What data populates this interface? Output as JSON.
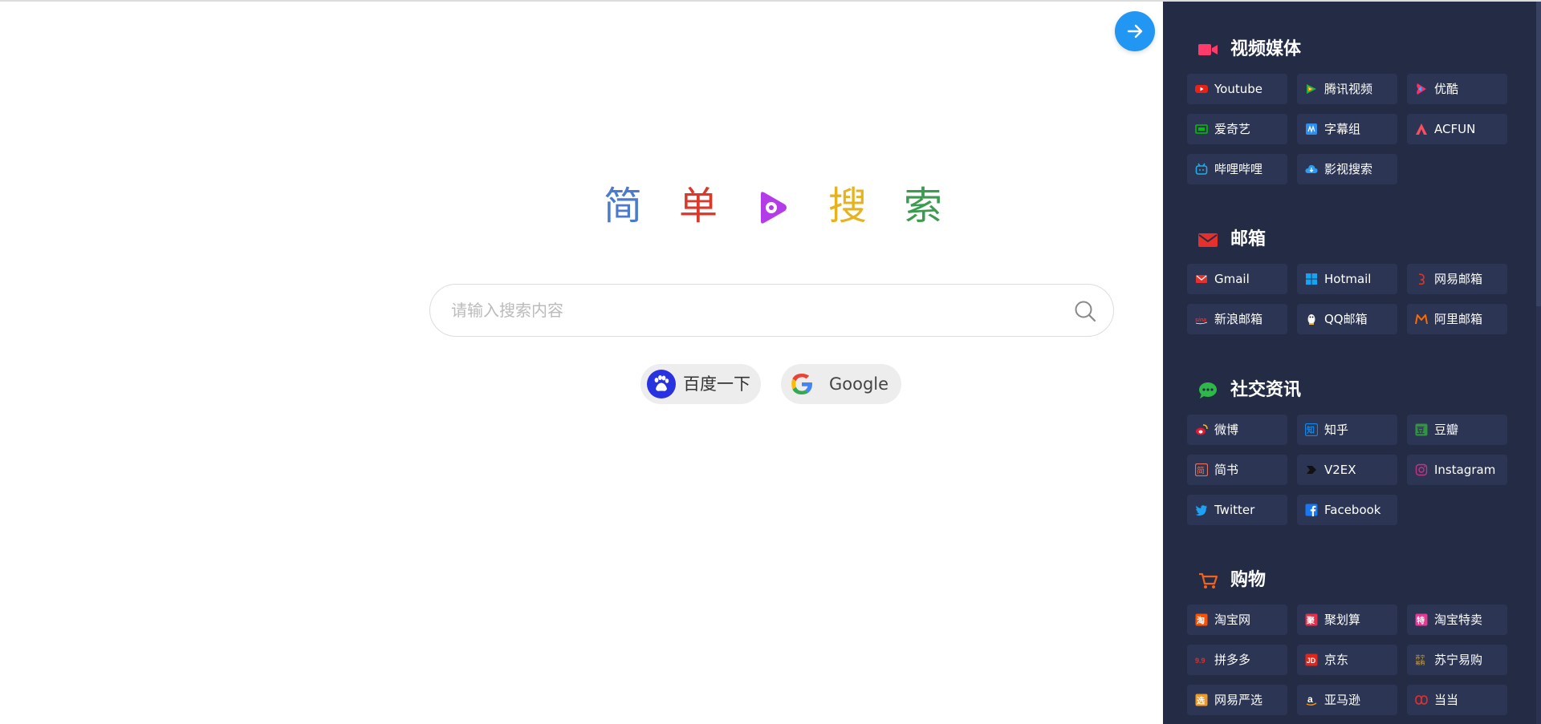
{
  "logo": {
    "chars": [
      "简",
      "单",
      "搜",
      "索"
    ],
    "colors": [
      "#4a7bd0",
      "#d9382b",
      "#e6b31e",
      "#3c9a51"
    ],
    "mark_color": "#b43ce8"
  },
  "search": {
    "placeholder": "请输入搜索内容",
    "value": ""
  },
  "engines": [
    {
      "label": "百度一下",
      "icon": "baidu-paw-icon"
    },
    {
      "label": "Google",
      "icon": "google-g-icon"
    }
  ],
  "toggle": {
    "icon": "arrow-right-icon",
    "color": "#2196f3"
  },
  "sidebar": {
    "background": "#232b45",
    "sections": [
      {
        "title": "视频媒体",
        "icon": "video-camera-icon",
        "icon_color": "#ff3b6b",
        "links": [
          {
            "label": "Youtube",
            "icon": "youtube-icon",
            "color": "#e62117"
          },
          {
            "label": "腾讯视频",
            "icon": "tencent-video-icon",
            "color": "#20b14a"
          },
          {
            "label": "优酷",
            "icon": "youku-icon",
            "color": "#ff2d6f"
          },
          {
            "label": "爱奇艺",
            "icon": "iqiyi-icon",
            "color": "#00be06"
          },
          {
            "label": "字幕组",
            "icon": "subtitle-icon",
            "color": "#2f8ff0"
          },
          {
            "label": "ACFUN",
            "icon": "acfun-icon",
            "color": "#fd4c5d"
          },
          {
            "label": "哔哩哔哩",
            "icon": "bilibili-icon",
            "color": "#23ade5"
          },
          {
            "label": "影视搜索",
            "icon": "cloud-icon",
            "color": "#2b9cf2"
          }
        ]
      },
      {
        "title": "邮箱",
        "icon": "envelope-icon",
        "icon_color": "#e5302b",
        "links": [
          {
            "label": "Gmail",
            "icon": "gmail-icon",
            "color": "#e5302b"
          },
          {
            "label": "Hotmail",
            "icon": "windows-icon",
            "color": "#12a5f4"
          },
          {
            "label": "网易邮箱",
            "icon": "netease-icon",
            "color": "#d6362b"
          },
          {
            "label": "新浪邮箱",
            "icon": "sina-icon",
            "color": "#e5302b"
          },
          {
            "label": "QQ邮箱",
            "icon": "qq-penguin-icon",
            "color": "#ffffff"
          },
          {
            "label": "阿里邮箱",
            "icon": "aliyun-mail-icon",
            "color": "#ff6a00"
          }
        ]
      },
      {
        "title": "社交资讯",
        "icon": "chat-bubble-icon",
        "icon_color": "#2fb84a",
        "links": [
          {
            "label": "微博",
            "icon": "weibo-icon",
            "color": "#e6162d"
          },
          {
            "label": "知乎",
            "icon": "zhihu-icon",
            "color": "#0f88eb"
          },
          {
            "label": "豆瓣",
            "icon": "douban-icon",
            "color": "#2e963d"
          },
          {
            "label": "简书",
            "icon": "jianshu-icon",
            "color": "#ea6f5a"
          },
          {
            "label": "V2EX",
            "icon": "v2ex-icon",
            "color": "#111111"
          },
          {
            "label": "Instagram",
            "icon": "instagram-icon",
            "color": "#c13584"
          },
          {
            "label": "Twitter",
            "icon": "twitter-bird-icon",
            "color": "#1da1f2"
          },
          {
            "label": "Facebook",
            "icon": "facebook-icon",
            "color": "#1877f2"
          }
        ]
      },
      {
        "title": "购物",
        "icon": "shopping-cart-icon",
        "icon_color": "#f0631e",
        "links": [
          {
            "label": "淘宝网",
            "icon": "taobao-icon",
            "color": "#ff5000"
          },
          {
            "label": "聚划算",
            "icon": "juhuasuan-icon",
            "color": "#e5304b"
          },
          {
            "label": "淘宝特卖",
            "icon": "temai-icon",
            "color": "#e53994"
          },
          {
            "label": "拼多多",
            "icon": "pinduoduo-icon",
            "color": "#e02e24"
          },
          {
            "label": "京东",
            "icon": "jd-icon",
            "color": "#e1251b"
          },
          {
            "label": "苏宁易购",
            "icon": "suning-icon",
            "color": "#f9b61b"
          },
          {
            "label": "网易严选",
            "icon": "yanxuan-icon",
            "color": "#f09a25"
          },
          {
            "label": "亚马逊",
            "icon": "amazon-icon",
            "color": "#ffffff"
          },
          {
            "label": "当当",
            "icon": "dangdang-icon",
            "color": "#e5302b"
          }
        ]
      }
    ]
  }
}
